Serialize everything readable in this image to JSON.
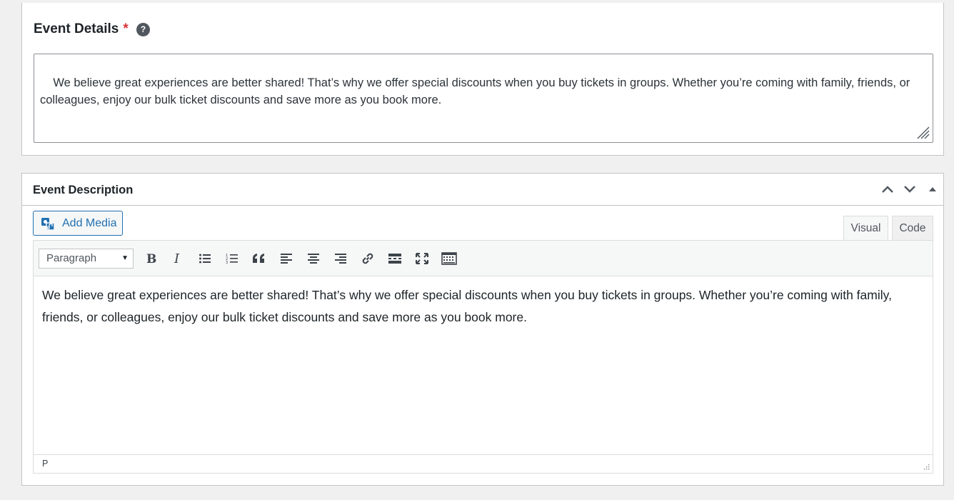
{
  "details": {
    "title": "Event Details",
    "required_mark": "*",
    "help_glyph": "?",
    "text": "We believe great experiences are better shared! That’s why we offer special discounts when you buy tickets in groups. Whether you’re coming with family, friends, or colleagues, enjoy our bulk ticket discounts and save more as you book more."
  },
  "description": {
    "title": "Event Description",
    "add_media_label": "Add Media",
    "tabs": {
      "visual": "Visual",
      "code": "Code"
    },
    "format_select": "Paragraph",
    "content": "We believe great experiences are better shared! That’s why we offer special discounts when you buy tickets in groups. Whether you’re coming with family, friends, or colleagues, enjoy our bulk ticket discounts and save more as you book more.",
    "status_path": "P"
  },
  "colors": {
    "accent": "#2271b1",
    "required": "#d63638",
    "text": "#1d2327"
  },
  "icons": [
    "help-icon",
    "chevron-up-icon",
    "chevron-down-icon",
    "triangle-up-icon",
    "add-media-icon",
    "bold-icon",
    "italic-icon",
    "bullet-list-icon",
    "numbered-list-icon",
    "blockquote-icon",
    "align-left-icon",
    "align-center-icon",
    "align-right-icon",
    "link-icon",
    "read-more-icon",
    "fullscreen-icon",
    "toolbar-toggle-icon",
    "resize-grip-icon"
  ]
}
